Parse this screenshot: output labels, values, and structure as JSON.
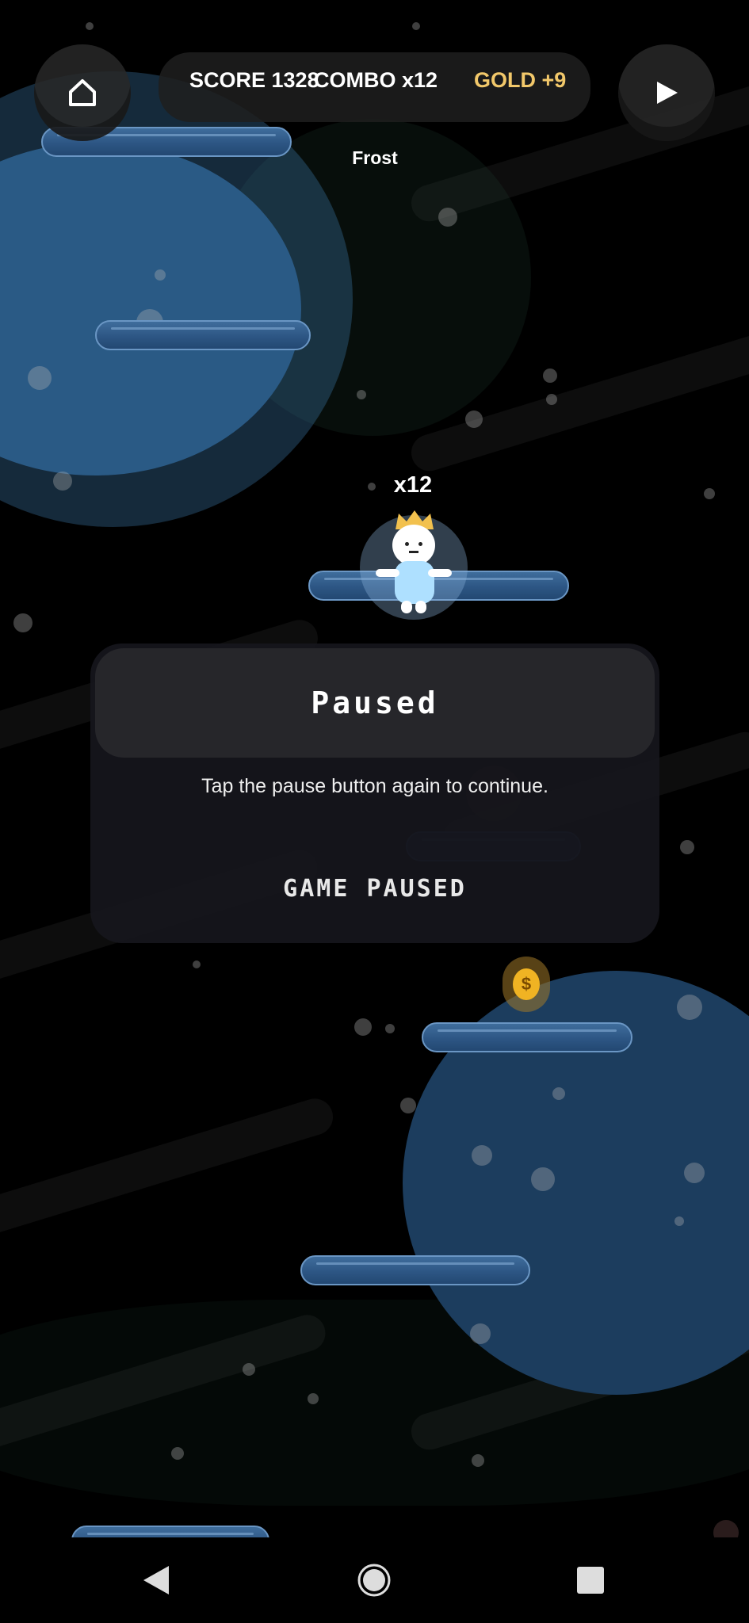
{
  "hud": {
    "score_text": "SCORE 1328",
    "combo_text": "COMBO x12",
    "gold_text": "GOLD +9",
    "home_icon": "home-icon",
    "play_icon": "play-icon",
    "gold_color": "#f2c86a"
  },
  "world": {
    "zone_label": "Frost",
    "player_combo": "x12",
    "coin_symbol": "$"
  },
  "pause_panel": {
    "title": "Paused",
    "message": "Tap the pause button again to continue.",
    "status": "GAME PAUSED"
  },
  "nav": {
    "back_icon": "back-triangle-icon",
    "home_icon": "home-circle-icon",
    "recents_icon": "recents-square-icon"
  },
  "colors": {
    "platform": "#2d5684",
    "planet": "#2b5a86",
    "coin": "#f0b323"
  }
}
